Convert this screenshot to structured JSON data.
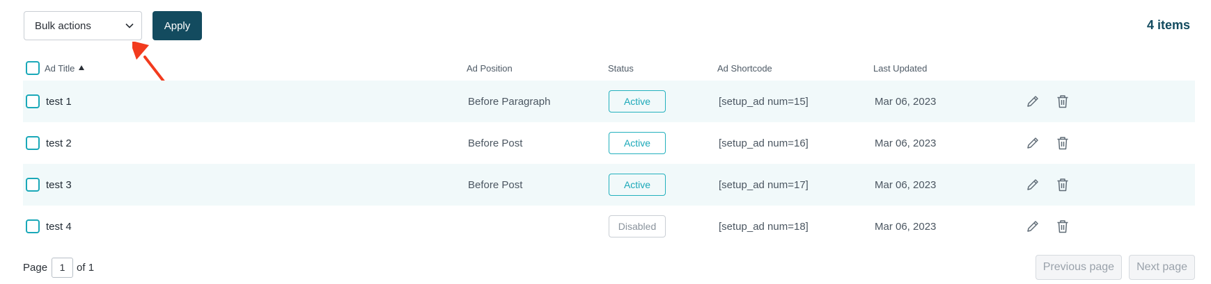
{
  "toolbar": {
    "bulk_select_value": "Bulk actions",
    "apply_label": "Apply",
    "items_count": "4 items"
  },
  "table": {
    "headers": {
      "ad_title": "Ad Title",
      "ad_position": "Ad Position",
      "status": "Status",
      "ad_shortcode": "Ad Shortcode",
      "last_updated": "Last Updated"
    },
    "rows": [
      {
        "title": "test 1",
        "position": "Before Paragraph",
        "status": "Active",
        "shortcode": "[setup_ad num=15]",
        "updated": "Mar 06, 2023"
      },
      {
        "title": "test 2",
        "position": "Before Post",
        "status": "Active",
        "shortcode": "[setup_ad num=16]",
        "updated": "Mar 06, 2023"
      },
      {
        "title": "test 3",
        "position": "Before Post",
        "status": "Active",
        "shortcode": "[setup_ad num=17]",
        "updated": "Mar 06, 2023"
      },
      {
        "title": "test 4",
        "position": "",
        "status": "Disabled",
        "shortcode": "[setup_ad num=18]",
        "updated": "Mar 06, 2023"
      }
    ]
  },
  "pagination": {
    "page_label": "Page",
    "current_page": "1",
    "of_label": "of 1",
    "prev_label": "Previous page",
    "next_label": "Next page"
  },
  "colors": {
    "primary": "#134b5f",
    "accent": "#1aa8b8",
    "row_alt": "#f1f9fa",
    "annotation_arrow": "#f23b1e"
  },
  "icons": [
    "chevron-down-icon",
    "sort-ascending-icon",
    "pencil-icon",
    "trash-icon",
    "annotation-arrow-icon"
  ]
}
